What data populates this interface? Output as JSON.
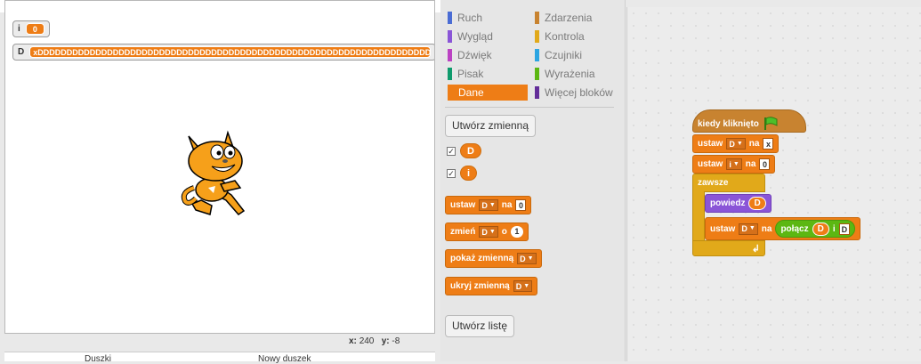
{
  "stage": {
    "version": "v458",
    "monitors": [
      {
        "label": "i",
        "value": "0"
      },
      {
        "label": "D",
        "value": "xDDDDDDDDDDDDDDDDDDDDDDDDDDDDDDDDDDDDDDDDDDDDDDDDDDDDDDDDDDDDDDDDDDDDDDDDDDDDDDDDDDDDDDDDDDDDDDDDDDDDDDD"
      }
    ],
    "coords": {
      "x_label": "x:",
      "x": "240",
      "y_label": "y:",
      "y": "-8"
    },
    "sprite_label": "Duszki",
    "new_sprite_label": "Nowy duszek"
  },
  "categories": [
    {
      "label": "Ruch",
      "color": "#4a6cd4"
    },
    {
      "label": "Zdarzenia",
      "color": "#c88330"
    },
    {
      "label": "Wygląd",
      "color": "#8a55d7"
    },
    {
      "label": "Kontrola",
      "color": "#e1a91a"
    },
    {
      "label": "Dźwięk",
      "color": "#bb42c3"
    },
    {
      "label": "Czujniki",
      "color": "#2ca5e2"
    },
    {
      "label": "Pisak",
      "color": "#0e9a6c"
    },
    {
      "label": "Wyrażenia",
      "color": "#5cb712"
    },
    {
      "label": "Dane",
      "color": "#ee7d16"
    },
    {
      "label": "Więcej bloków",
      "color": "#632d99"
    }
  ],
  "palette": {
    "make_var": "Utwórz zmienną",
    "make_list": "Utwórz listę",
    "vars": [
      "D",
      "i"
    ],
    "set": {
      "a": "ustaw",
      "var": "D",
      "b": "na",
      "val": "0"
    },
    "change": {
      "a": "zmień",
      "var": "D",
      "b": "o",
      "val": "1"
    },
    "show": {
      "a": "pokaż zmienną",
      "var": "D"
    },
    "hide": {
      "a": "ukryj zmienną",
      "var": "D"
    }
  },
  "script": {
    "hat": "kiedy kliknięto",
    "set1": {
      "a": "ustaw",
      "var": "D",
      "b": "na",
      "val": "x"
    },
    "set2": {
      "a": "ustaw",
      "var": "i",
      "b": "na",
      "val": "0"
    },
    "forever": "zawsze",
    "say": {
      "a": "powiedz",
      "var": "D"
    },
    "set3": {
      "a": "ustaw",
      "var": "D",
      "b": "na",
      "join": "połącz",
      "r1": "D",
      "mid": "i",
      "r2": "D"
    }
  }
}
